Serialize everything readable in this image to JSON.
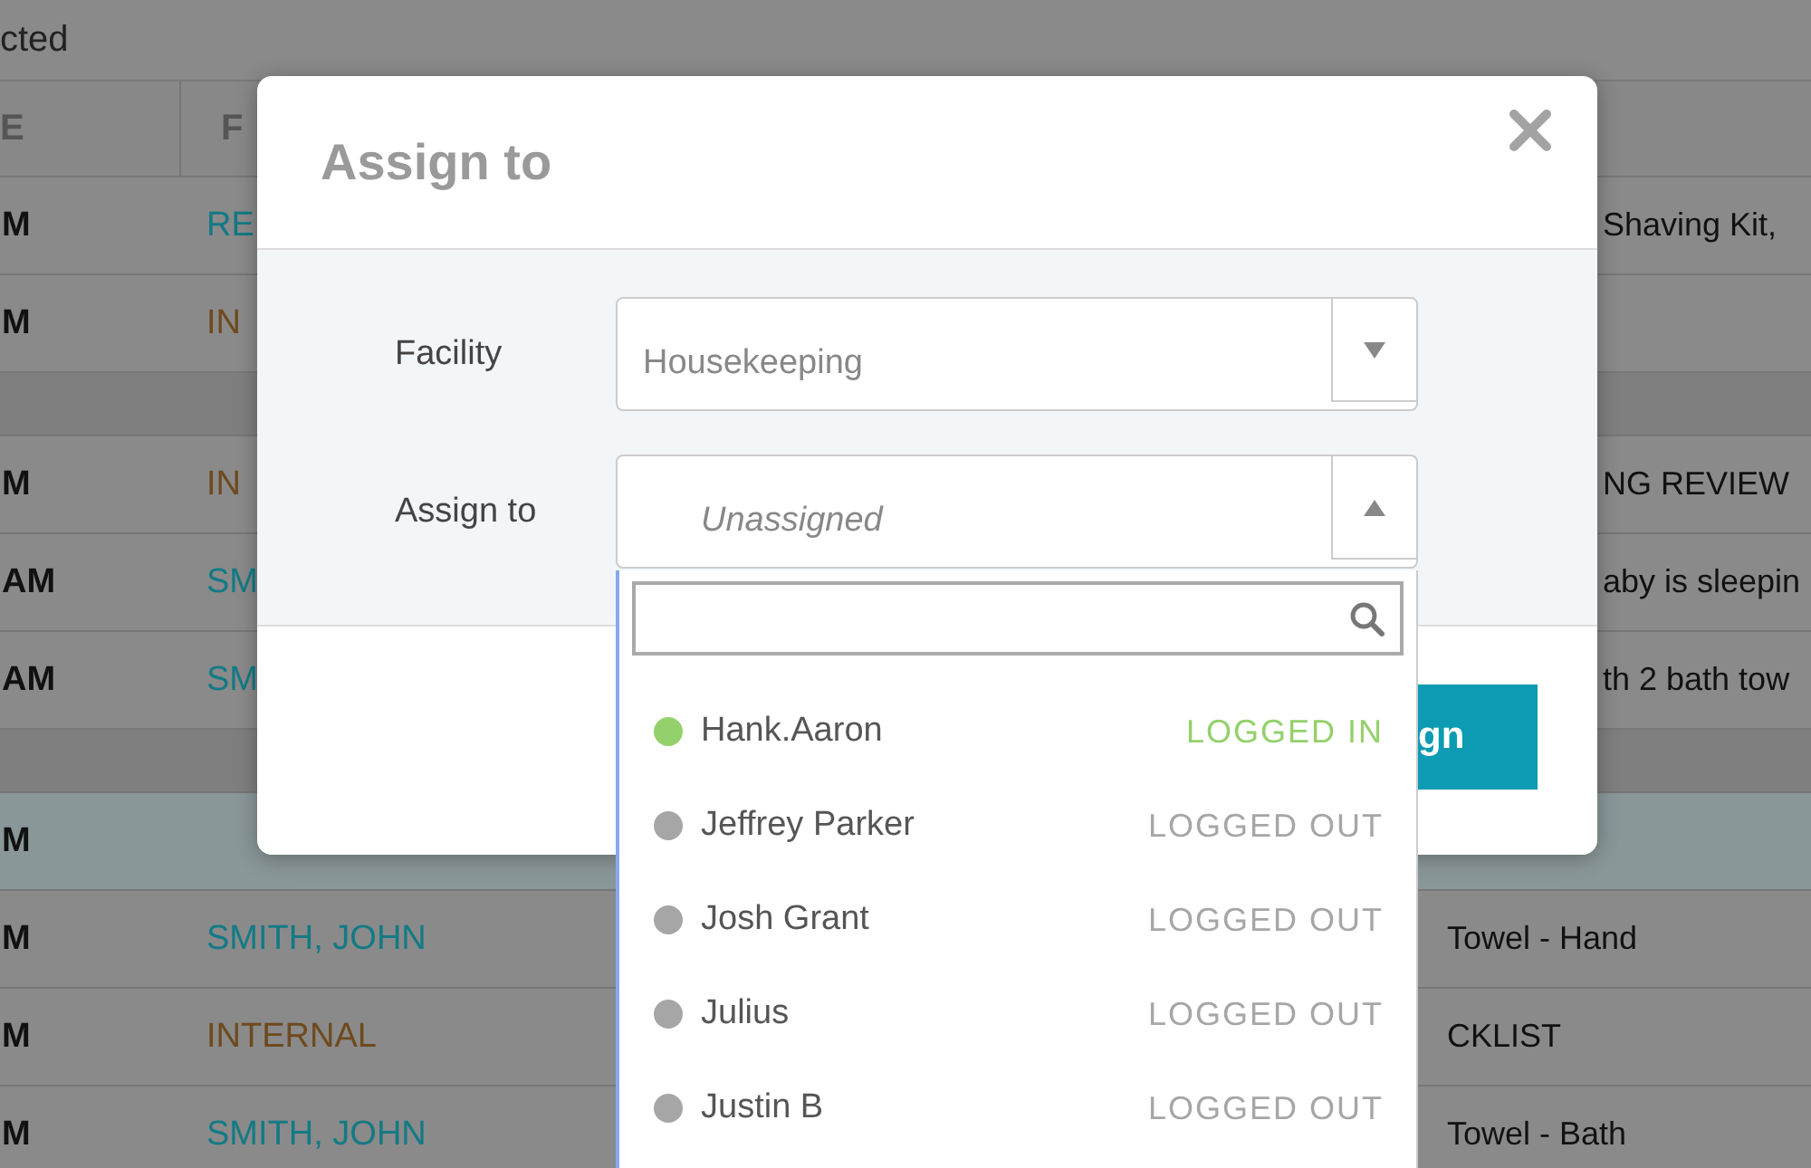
{
  "page": {
    "selection_text": "cted"
  },
  "table": {
    "columns": [
      "E",
      "F"
    ],
    "rows": [
      {
        "kind": "data",
        "selected": false,
        "under_dialog": true,
        "column_1": "M",
        "column_2": "RE",
        "color": "#137a85",
        "column_3": "Shaving Kit,"
      },
      {
        "kind": "data",
        "selected": false,
        "column_1": "M",
        "column_2": "IN",
        "color": "#6e4a1e"
      },
      {
        "kind": "group"
      },
      {
        "kind": "data",
        "selected": false,
        "under_dialog": true,
        "column_1": "M",
        "column_2": "IN",
        "color": "#6e4a1e",
        "column_3": "NG REVIEW"
      },
      {
        "kind": "data",
        "selected": false,
        "under_dialog": true,
        "column_1": "AM",
        "column_2": "SM",
        "color": "#137a85",
        "column_3": "aby is sleepin"
      },
      {
        "kind": "data",
        "selected": false,
        "under_dialog": true,
        "column_1": "AM",
        "column_2": "SM",
        "color": "#137a85",
        "column_3": "th 2 bath tow"
      },
      {
        "kind": "group"
      },
      {
        "kind": "data",
        "selected": true,
        "column_1": "M"
      },
      {
        "kind": "data",
        "selected": false,
        "column_1": "M",
        "column_2": "SMITH, JOHN",
        "color": "#137a85",
        "column_3": "Towel - Hand"
      },
      {
        "kind": "data",
        "selected": false,
        "column_1": "M",
        "column_2": "INTERNAL",
        "color": "#6e4a1e",
        "column_3": "CKLIST"
      },
      {
        "kind": "data",
        "selected": false,
        "column_1": "M",
        "column_2": "SMITH, JOHN",
        "color": "#137a85",
        "column_3": "Towel - Bath"
      }
    ]
  },
  "dialog": {
    "title": "Assign to",
    "fields": [
      {
        "label": "Facility",
        "value": "Housekeeping",
        "expanded": false
      },
      {
        "label": "Assign to",
        "placeholder": "Unassigned",
        "expanded": true
      }
    ],
    "assign_button": "gn",
    "list": {
      "items": [
        {
          "name": "Hank.Aaron",
          "status": "LOGGED IN",
          "color": "#94d06c"
        },
        {
          "name": "Jeffrey Parker",
          "status": "LOGGED OUT",
          "color": "#a6a6a6"
        },
        {
          "name": "Josh Grant",
          "status": "LOGGED OUT",
          "color": "#a6a6a6"
        },
        {
          "name": "Julius",
          "status": "LOGGED OUT",
          "color": "#a6a6a6"
        },
        {
          "name": "Justin B",
          "status": "LOGGED OUT",
          "color": "#a6a6a6"
        }
      ]
    }
  }
}
